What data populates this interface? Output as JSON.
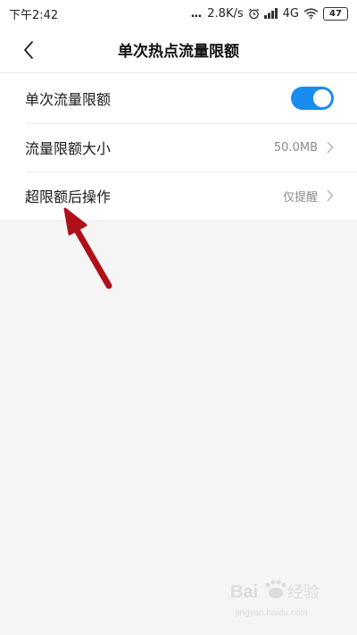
{
  "status_bar": {
    "time": "下午2:42",
    "dots": "...",
    "speed": "2.8K/s",
    "network": "4G",
    "battery": "47"
  },
  "header": {
    "title": "单次热点流量限额"
  },
  "settings": {
    "items": [
      {
        "label": "单次流量限额",
        "toggle_on": true
      },
      {
        "label": "流量限额大小",
        "value": "50.0MB"
      },
      {
        "label": "超限额后操作",
        "value": "仅提醒"
      }
    ]
  },
  "watermark": {
    "text": "Baidu经验",
    "sub": "jingyan.baidu.com"
  },
  "colors": {
    "accent": "#1a8cf0",
    "annotation": "#b0101a"
  }
}
